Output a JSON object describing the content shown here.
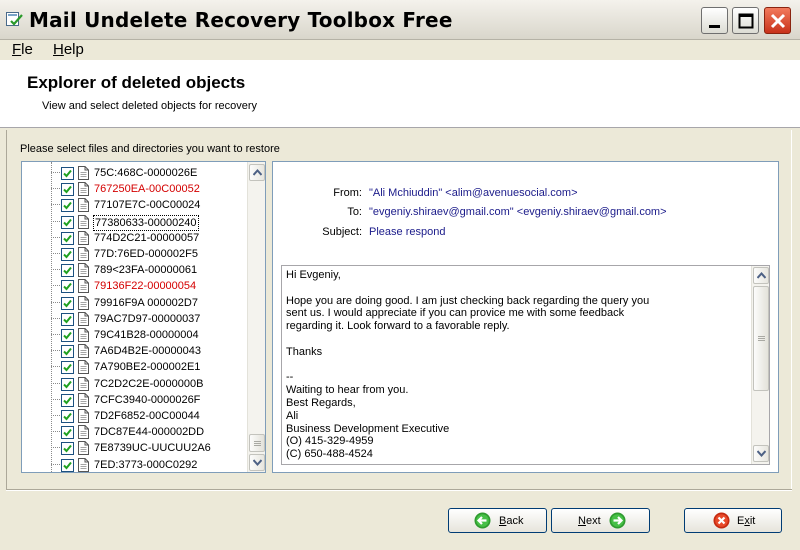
{
  "window": {
    "title": "Mail Undelete Recovery Toolbox Free"
  },
  "menu": {
    "file_label": "Fle",
    "help_label": "Help"
  },
  "header": {
    "title": "Explorer of deleted objects",
    "subtitle": "View and select deleted objects for recovery"
  },
  "prompt": "Please select files and directories you want to restore",
  "tree": {
    "items": [
      {
        "label": "75C:468C-0000026E",
        "color": "normal",
        "checked": true
      },
      {
        "label": "767250EA-00C00052",
        "color": "red",
        "checked": true
      },
      {
        "label": "77107E7C-00C00024",
        "color": "normal",
        "checked": true
      },
      {
        "label": "77380633-00000240",
        "color": "selected",
        "checked": true
      },
      {
        "label": "774D2C21-00000057",
        "color": "normal",
        "checked": true
      },
      {
        "label": "77D:76ED-000002F5",
        "color": "normal",
        "checked": true
      },
      {
        "label": "789<23FA-00000061",
        "color": "normal",
        "checked": true
      },
      {
        "label": "79136F22-00000054",
        "color": "red",
        "checked": true
      },
      {
        "label": "79916F9A 000002D7",
        "color": "normal",
        "checked": true
      },
      {
        "label": "79AC7D97-00000037",
        "color": "normal",
        "checked": true
      },
      {
        "label": "79C41B28-00000004",
        "color": "normal",
        "checked": true
      },
      {
        "label": "7A6D4B2E-00000043",
        "color": "normal",
        "checked": true
      },
      {
        "label": "7A790BE2-000002E1",
        "color": "normal",
        "checked": true
      },
      {
        "label": "7C2D2C2E-0000000B",
        "color": "normal",
        "checked": true
      },
      {
        "label": "7CFC3940-0000026F",
        "color": "normal",
        "checked": true
      },
      {
        "label": "7D2F6852-00C00044",
        "color": "normal",
        "checked": true
      },
      {
        "label": "7DC87E44-000002DD",
        "color": "normal",
        "checked": true
      },
      {
        "label": "7E8739UC-UUCUU2A6",
        "color": "normal",
        "checked": true
      },
      {
        "label": "7ED:3773-000C0292",
        "color": "normal",
        "checked": true
      }
    ]
  },
  "message": {
    "from_label": "From:",
    "from_value": "\"Ali Mchiuddin\" <alim@avenuesocial.com>",
    "to_label": "To:",
    "to_value": "\"evgeniy.shiraev@gmail.com\" <evgeniy.shiraev@gmail.com>",
    "subject_label": "Subject:",
    "subject_value": "Please respond",
    "body": "Hi Evgeniy,\n\nHope you are doing good. I am just checking back regarding the query you\nsent us. I would appreciate if you can provice me with some feedback\nregarding it. Look forward to a favorable reply.\n\nThanks\n\n--\nWaiting to hear from you.\nBest Regards,\nAli\nBusiness Development Executive\n(O) 415-329-4959\n(C) 650-488-4524"
  },
  "buttons": {
    "back_label": "Back",
    "next_label": "Next",
    "exit_label": "Exit"
  },
  "colors": {
    "red_item": "#d40000",
    "header_value": "#1b1b8a",
    "selection_border": "#7f9db9"
  }
}
